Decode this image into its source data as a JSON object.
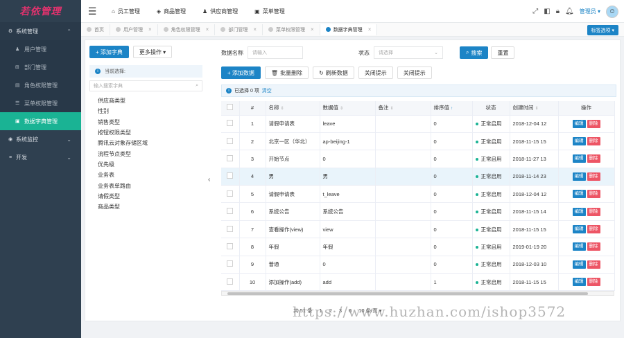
{
  "app": {
    "logo_text": "若依管理"
  },
  "header": {
    "nav": [
      {
        "icon": "⌂",
        "label": "员工管理"
      },
      {
        "icon": "◈",
        "label": "商品管理"
      },
      {
        "icon": "♟",
        "label": "供应商管理"
      },
      {
        "icon": "▣",
        "label": "菜单管理"
      }
    ],
    "user_name": "管理员 ▾"
  },
  "sidebar": {
    "group1": {
      "label": "系统管理",
      "arrow": "⌃"
    },
    "items": [
      {
        "icon": "♟",
        "label": "用户管理"
      },
      {
        "icon": "⊞",
        "label": "部门管理"
      },
      {
        "icon": "▤",
        "label": "角色权限管理"
      },
      {
        "icon": "☰",
        "label": "菜单权限管理"
      },
      {
        "icon": "▣",
        "label": "数据字典管理"
      }
    ],
    "group2": {
      "label": "系统监控",
      "arrow": "⌄"
    },
    "group3": {
      "label": "开发",
      "arrow": "⌄"
    }
  },
  "tabs": [
    {
      "label": "首页"
    },
    {
      "label": "用户管理"
    },
    {
      "label": "角色权限管理"
    },
    {
      "label": "部门管理"
    },
    {
      "label": "菜单权限管理"
    },
    {
      "label": "数据字典管理"
    }
  ],
  "tab_options_label": "标签选项 ▾",
  "left_panel": {
    "add_type_label": "+ 添加字典",
    "more_ops_label": "更多操作 ▾",
    "current_select_label": "当前选择:",
    "search_placeholder": "输入搜索字典",
    "tree_items": [
      "供应商类型",
      "性别",
      "销售类型",
      "按钮权限类型",
      "腾讯云对象存储区域",
      "流程节点类型",
      "优先级",
      "业务表",
      "业务表单路由",
      "请假类型",
      "商品类型"
    ]
  },
  "search": {
    "name_label": "数据名称",
    "name_placeholder": "请输入",
    "status_label": "状态",
    "status_placeholder": "请选择",
    "search_button": "搜索",
    "reset_button": "重置"
  },
  "toolbar": {
    "add": "+ 添加数据",
    "batch_delete": "批量删除",
    "refresh": "刷新数据",
    "close_tip": "关闭提示",
    "close_tip2": "关闭提示"
  },
  "alert": {
    "text": "已选择 0 项",
    "clear": "清空"
  },
  "table": {
    "headers": [
      "#",
      "名称",
      "数据值",
      "备注",
      "排序值",
      "状态",
      "创建时间",
      "操作"
    ],
    "edit_label": "编辑",
    "delete_label": "删除",
    "rows": [
      {
        "no": "1",
        "name": "请假申请表",
        "value": "leave",
        "remark": "",
        "sort": "0",
        "status": "正常启用",
        "time": "2018-12-04 12"
      },
      {
        "no": "2",
        "name": "北京一区（华北）",
        "value": "ap-beijing-1",
        "remark": "",
        "sort": "0",
        "status": "正常启用",
        "time": "2018-11-15 15"
      },
      {
        "no": "3",
        "name": "开始节点",
        "value": "0",
        "remark": "",
        "sort": "0",
        "status": "正常启用",
        "time": "2018-11-27 13"
      },
      {
        "no": "4",
        "name": "男",
        "value": "男",
        "remark": "",
        "sort": "0",
        "status": "正常启用",
        "time": "2018-11-14 23"
      },
      {
        "no": "5",
        "name": "请假申请表",
        "value": "t_leave",
        "remark": "",
        "sort": "0",
        "status": "正常启用",
        "time": "2018-12-04 12"
      },
      {
        "no": "6",
        "name": "系统公告",
        "value": "系统公告",
        "remark": "",
        "sort": "0",
        "status": "正常启用",
        "time": "2018-11-15 14"
      },
      {
        "no": "7",
        "name": "查看操作(view)",
        "value": "view",
        "remark": "",
        "sort": "0",
        "status": "正常启用",
        "time": "2018-11-15 15"
      },
      {
        "no": "8",
        "name": "年假",
        "value": "年假",
        "remark": "",
        "sort": "0",
        "status": "正常启用",
        "time": "2019-01-19 20"
      },
      {
        "no": "9",
        "name": "普通",
        "value": "0",
        "remark": "",
        "sort": "0",
        "status": "正常启用",
        "time": "2018-12-03 10"
      },
      {
        "no": "10",
        "name": "添加操作(add)",
        "value": "add",
        "remark": "",
        "sort": "1",
        "status": "正常启用",
        "time": "2018-11-15 15"
      }
    ]
  },
  "pager": {
    "total": "共 51 条",
    "p1": "1",
    "p2": "2",
    "p3": "3",
    "p6": "6",
    "size": "10 条/页 ▾"
  },
  "watermark": "https://www.huzhan.com/ishop3572"
}
